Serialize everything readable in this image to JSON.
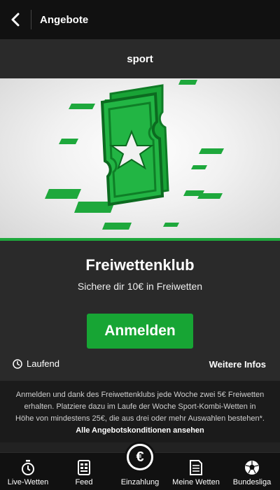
{
  "header": {
    "title": "Angebote"
  },
  "subheader": {
    "title": "sport"
  },
  "promo": {
    "title": "Freiwettenklub",
    "subtitle": "Sichere dir 10€ in Freiwetten",
    "cta_label": "Anmelden",
    "status": "Laufend",
    "more_info": "Weitere Infos",
    "terms_text": "Anmelden und dank des Freiwettenklubs jede Woche zwei 5€ Freiwetten erhalten. Platziere dazu im Laufe der Woche Sport-Kombi-Wetten in Höhe von mindestens 25€, die aus drei oder mehr Auswahlen bestehen*.",
    "terms_link": "Alle Angebotskonditionen ansehen"
  },
  "tabs": [
    {
      "label": "Live-Wetten",
      "icon": "stopwatch-icon"
    },
    {
      "label": "Feed",
      "icon": "feed-icon"
    },
    {
      "label": "Einzahlung",
      "icon": "euro-icon"
    },
    {
      "label": "Meine Wetten",
      "icon": "betslip-icon"
    },
    {
      "label": "Bundesliga",
      "icon": "football-icon"
    }
  ],
  "colors": {
    "accent": "#17a534",
    "background": "#2a2a2a",
    "topbar": "#111111"
  }
}
